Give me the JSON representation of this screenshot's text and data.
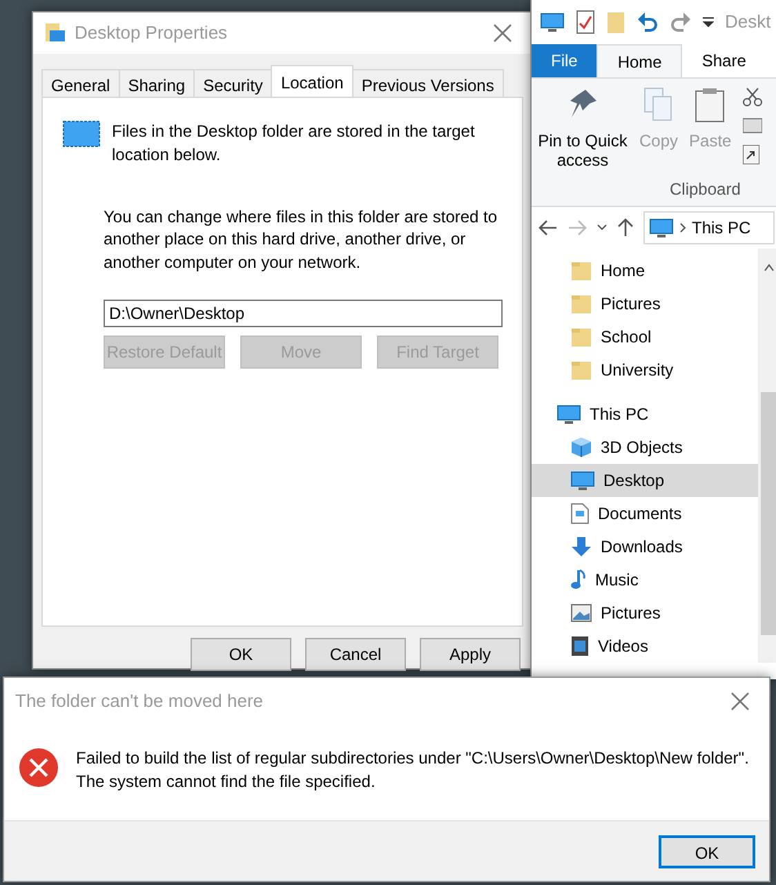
{
  "properties_dialog": {
    "title": "Desktop Properties",
    "tabs": [
      {
        "label": "General",
        "selected": false
      },
      {
        "label": "Sharing",
        "selected": false
      },
      {
        "label": "Security",
        "selected": false
      },
      {
        "label": "Location",
        "selected": true
      },
      {
        "label": "Previous Versions",
        "selected": false
      }
    ],
    "description": "Files in the Desktop folder are stored in the target location below.",
    "info": "You can change where files in this folder are stored to another place on this hard drive, another drive, or another computer on your network.",
    "path_field": {
      "value": "D:\\Owner\\Desktop"
    },
    "location_buttons": [
      {
        "label": "Restore Default",
        "disabled": true
      },
      {
        "label": "Move",
        "disabled": true
      },
      {
        "label": "Find Target",
        "disabled": true
      }
    ],
    "buttons": [
      {
        "label": "OK",
        "disabled": false
      },
      {
        "label": "Cancel",
        "disabled": false
      },
      {
        "label": "Apply",
        "disabled": false
      }
    ]
  },
  "explorer": {
    "title": "Deskt",
    "ribbon_tabs": [
      {
        "label": "File",
        "kind": "file",
        "selected": false
      },
      {
        "label": "Home",
        "kind": "tab",
        "selected": true
      },
      {
        "label": "Share",
        "kind": "tab",
        "selected": false
      }
    ],
    "ribbon_commands": [
      {
        "label": "Pin to Quick access",
        "disabled": false
      },
      {
        "label": "Copy",
        "disabled": true
      },
      {
        "label": "Paste",
        "disabled": true
      }
    ],
    "group_label": "Clipboard",
    "address": "This PC",
    "quick_access_items": [
      {
        "label": "Home",
        "selected": false
      },
      {
        "label": "Pictures",
        "selected": false
      },
      {
        "label": "School",
        "selected": false
      },
      {
        "label": "University",
        "selected": false
      }
    ],
    "this_pc": {
      "label": "This PC",
      "selected": false,
      "children": [
        {
          "label": "3D Objects",
          "selected": false
        },
        {
          "label": "Desktop",
          "selected": true
        },
        {
          "label": "Documents",
          "selected": false
        },
        {
          "label": "Downloads",
          "selected": false
        },
        {
          "label": "Music",
          "selected": false
        },
        {
          "label": "Pictures",
          "selected": false
        },
        {
          "label": "Videos",
          "selected": false
        }
      ]
    }
  },
  "error_dialog": {
    "title": "The folder can't be moved here",
    "message": "Failed to build the list of regular subdirectories under \"C:\\Users\\Owner\\Desktop\\New folder\".",
    "detail": "The system cannot find the file specified.",
    "buttons": [
      {
        "label": "OK",
        "default": true
      }
    ]
  }
}
